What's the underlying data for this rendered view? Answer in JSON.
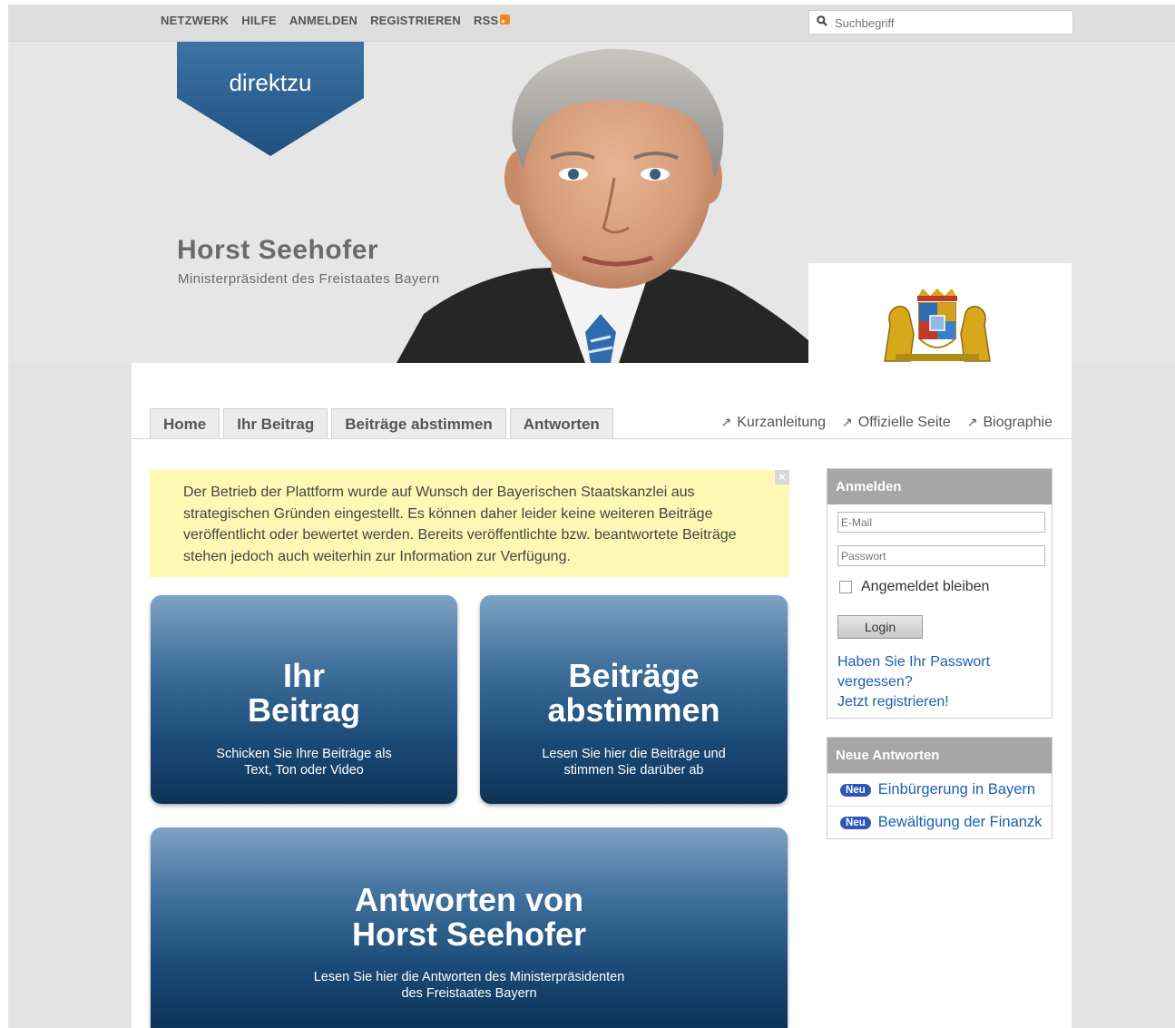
{
  "topnav": {
    "items": [
      "NETZWERK",
      "HILFE",
      "ANMELDEN",
      "REGISTRIEREN",
      "RSS"
    ],
    "search_placeholder": "Suchbegriff"
  },
  "header": {
    "brand": "direktzu",
    "person_name": "Horst Seehofer",
    "person_title": "Ministerpräsident des Freistaates Bayern"
  },
  "tabs": [
    "Home",
    "Ihr Beitrag",
    "Beiträge abstimmen",
    "Antworten"
  ],
  "ext_links": [
    "Kurzanleitung",
    "Offizielle Seite",
    "Biographie"
  ],
  "notice": {
    "text": "Der Betrieb der Plattform wurde auf Wunsch der Bayerischen Staatskanzlei aus strategischen Gründen eingestellt. Es können daher leider keine weiteren Beiträge veröffentlicht oder bewertet werden. Bereits veröffentlichte bzw. beantwortete Beiträge stehen jedoch auch weiterhin zur Information zur Verfügung.",
    "close": "×"
  },
  "tiles": {
    "beitrag": {
      "title1": "Ihr",
      "title2": "Beitrag",
      "sub1": "Schicken Sie Ihre Beiträge als",
      "sub2": "Text, Ton oder Video"
    },
    "abstimmen": {
      "title1": "Beiträge",
      "title2": "abstimmen",
      "sub1": "Lesen Sie hier die Beiträge und",
      "sub2": "stimmen Sie darüber ab"
    },
    "antworten": {
      "title1": "Antworten von",
      "title2": "Horst Seehofer",
      "sub1": "Lesen Sie hier die Antworten des Ministerpräsidenten",
      "sub2": "des Freistaates Bayern"
    }
  },
  "login": {
    "heading": "Anmelden",
    "email_placeholder": "E-Mail",
    "password_placeholder": "Passwort",
    "remember": "Angemeldet bleiben",
    "button": "Login",
    "forgot1": "Haben Sie Ihr Passwort",
    "forgot2": "vergessen?",
    "register": "Jetzt registrieren!"
  },
  "answers": {
    "heading": "Neue Antworten",
    "badge": "Neu",
    "items": [
      "Einbürgerung in Bayern",
      "Bewältigung der Finanzk"
    ]
  },
  "colors": {
    "tile_top": "#7fa3c4",
    "tile_bottom": "#0e3358",
    "notice_bg": "#fdf9b4",
    "link": "#1a5fb4",
    "badge": "#2a57b8",
    "brand_blue": "#2d5f8f"
  }
}
